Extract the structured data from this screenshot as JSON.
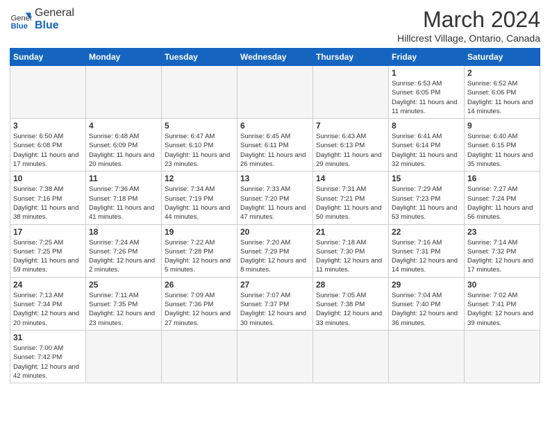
{
  "header": {
    "logo_general": "General",
    "logo_blue": "Blue",
    "month_title": "March 2024",
    "location": "Hillcrest Village, Ontario, Canada"
  },
  "weekdays": [
    "Sunday",
    "Monday",
    "Tuesday",
    "Wednesday",
    "Thursday",
    "Friday",
    "Saturday"
  ],
  "weeks": [
    [
      {
        "day": "",
        "info": ""
      },
      {
        "day": "",
        "info": ""
      },
      {
        "day": "",
        "info": ""
      },
      {
        "day": "",
        "info": ""
      },
      {
        "day": "",
        "info": ""
      },
      {
        "day": "1",
        "info": "Sunrise: 6:53 AM\nSunset: 6:05 PM\nDaylight: 11 hours and 11 minutes."
      },
      {
        "day": "2",
        "info": "Sunrise: 6:52 AM\nSunset: 6:06 PM\nDaylight: 11 hours and 14 minutes."
      }
    ],
    [
      {
        "day": "3",
        "info": "Sunrise: 6:50 AM\nSunset: 6:08 PM\nDaylight: 11 hours and 17 minutes."
      },
      {
        "day": "4",
        "info": "Sunrise: 6:48 AM\nSunset: 6:09 PM\nDaylight: 11 hours and 20 minutes."
      },
      {
        "day": "5",
        "info": "Sunrise: 6:47 AM\nSunset: 6:10 PM\nDaylight: 11 hours and 23 minutes."
      },
      {
        "day": "6",
        "info": "Sunrise: 6:45 AM\nSunset: 6:11 PM\nDaylight: 11 hours and 26 minutes."
      },
      {
        "day": "7",
        "info": "Sunrise: 6:43 AM\nSunset: 6:13 PM\nDaylight: 11 hours and 29 minutes."
      },
      {
        "day": "8",
        "info": "Sunrise: 6:41 AM\nSunset: 6:14 PM\nDaylight: 11 hours and 32 minutes."
      },
      {
        "day": "9",
        "info": "Sunrise: 6:40 AM\nSunset: 6:15 PM\nDaylight: 11 hours and 35 minutes."
      }
    ],
    [
      {
        "day": "10",
        "info": "Sunrise: 7:38 AM\nSunset: 7:16 PM\nDaylight: 11 hours and 38 minutes."
      },
      {
        "day": "11",
        "info": "Sunrise: 7:36 AM\nSunset: 7:18 PM\nDaylight: 11 hours and 41 minutes."
      },
      {
        "day": "12",
        "info": "Sunrise: 7:34 AM\nSunset: 7:19 PM\nDaylight: 11 hours and 44 minutes."
      },
      {
        "day": "13",
        "info": "Sunrise: 7:33 AM\nSunset: 7:20 PM\nDaylight: 11 hours and 47 minutes."
      },
      {
        "day": "14",
        "info": "Sunrise: 7:31 AM\nSunset: 7:21 PM\nDaylight: 11 hours and 50 minutes."
      },
      {
        "day": "15",
        "info": "Sunrise: 7:29 AM\nSunset: 7:23 PM\nDaylight: 11 hours and 53 minutes."
      },
      {
        "day": "16",
        "info": "Sunrise: 7:27 AM\nSunset: 7:24 PM\nDaylight: 11 hours and 56 minutes."
      }
    ],
    [
      {
        "day": "17",
        "info": "Sunrise: 7:25 AM\nSunset: 7:25 PM\nDaylight: 11 hours and 59 minutes."
      },
      {
        "day": "18",
        "info": "Sunrise: 7:24 AM\nSunset: 7:26 PM\nDaylight: 12 hours and 2 minutes."
      },
      {
        "day": "19",
        "info": "Sunrise: 7:22 AM\nSunset: 7:28 PM\nDaylight: 12 hours and 5 minutes."
      },
      {
        "day": "20",
        "info": "Sunrise: 7:20 AM\nSunset: 7:29 PM\nDaylight: 12 hours and 8 minutes."
      },
      {
        "day": "21",
        "info": "Sunrise: 7:18 AM\nSunset: 7:30 PM\nDaylight: 12 hours and 11 minutes."
      },
      {
        "day": "22",
        "info": "Sunrise: 7:16 AM\nSunset: 7:31 PM\nDaylight: 12 hours and 14 minutes."
      },
      {
        "day": "23",
        "info": "Sunrise: 7:14 AM\nSunset: 7:32 PM\nDaylight: 12 hours and 17 minutes."
      }
    ],
    [
      {
        "day": "24",
        "info": "Sunrise: 7:13 AM\nSunset: 7:34 PM\nDaylight: 12 hours and 20 minutes."
      },
      {
        "day": "25",
        "info": "Sunrise: 7:11 AM\nSunset: 7:35 PM\nDaylight: 12 hours and 23 minutes."
      },
      {
        "day": "26",
        "info": "Sunrise: 7:09 AM\nSunset: 7:36 PM\nDaylight: 12 hours and 27 minutes."
      },
      {
        "day": "27",
        "info": "Sunrise: 7:07 AM\nSunset: 7:37 PM\nDaylight: 12 hours and 30 minutes."
      },
      {
        "day": "28",
        "info": "Sunrise: 7:05 AM\nSunset: 7:38 PM\nDaylight: 12 hours and 33 minutes."
      },
      {
        "day": "29",
        "info": "Sunrise: 7:04 AM\nSunset: 7:40 PM\nDaylight: 12 hours and 36 minutes."
      },
      {
        "day": "30",
        "info": "Sunrise: 7:02 AM\nSunset: 7:41 PM\nDaylight: 12 hours and 39 minutes."
      }
    ],
    [
      {
        "day": "31",
        "info": "Sunrise: 7:00 AM\nSunset: 7:42 PM\nDaylight: 12 hours and 42 minutes."
      },
      {
        "day": "",
        "info": ""
      },
      {
        "day": "",
        "info": ""
      },
      {
        "day": "",
        "info": ""
      },
      {
        "day": "",
        "info": ""
      },
      {
        "day": "",
        "info": ""
      },
      {
        "day": "",
        "info": ""
      }
    ]
  ]
}
